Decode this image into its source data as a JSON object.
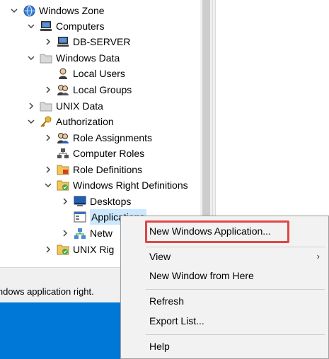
{
  "tree": {
    "items": [
      {
        "label": "Windows Zone",
        "icon": "globe-icon"
      },
      {
        "label": "Computers",
        "icon": "computer-icon"
      },
      {
        "label": "DB-SERVER",
        "icon": "server-computer-icon"
      },
      {
        "label": "Windows Data",
        "icon": "folder-icon"
      },
      {
        "label": "Local Users",
        "icon": "user-icon"
      },
      {
        "label": "Local Groups",
        "icon": "group-icon"
      },
      {
        "label": "UNIX Data",
        "icon": "folder-icon"
      },
      {
        "label": "Authorization",
        "icon": "key-icon"
      },
      {
        "label": "Role Assignments",
        "icon": "role-assignment-icon"
      },
      {
        "label": "Computer Roles",
        "icon": "computer-roles-icon"
      },
      {
        "label": "Role Definitions",
        "icon": "role-definition-folder-icon"
      },
      {
        "label": "Windows Right Definitions",
        "icon": "rights-folder-icon"
      },
      {
        "label": "Desktops",
        "icon": "desktop-icon"
      },
      {
        "label": "Applications",
        "icon": "application-icon"
      },
      {
        "label": "Netw",
        "icon": "network-icon"
      },
      {
        "label": "UNIX Rig",
        "icon": "rights-folder-icon"
      }
    ]
  },
  "status": {
    "text": "indows application right."
  },
  "context_menu": {
    "items": [
      {
        "label": "New Windows Application..."
      },
      {
        "label": "View"
      },
      {
        "label": "New Window from Here"
      },
      {
        "label": "Refresh"
      },
      {
        "label": "Export List..."
      },
      {
        "label": "Help"
      }
    ],
    "submenu_arrow": "›"
  },
  "colors": {
    "selection": "#cce8ff",
    "highlight_border": "#e04646",
    "taskbar": "#0078d7",
    "menu_bg": "#f2f2f2"
  }
}
